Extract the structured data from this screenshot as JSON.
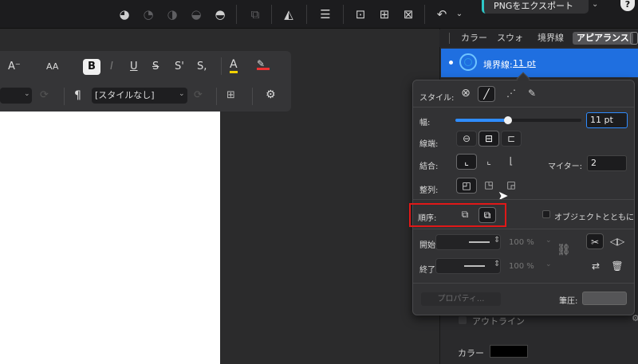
{
  "topbar": {
    "export_label": "PNGをエクスポート",
    "export_chevron": "⌄",
    "help_label": "?"
  },
  "textbar": {
    "font_decrease": "A⁻",
    "font_size_label": "AA",
    "bold": "B",
    "italic": "I",
    "underline": "U",
    "strike": "S",
    "superscript": "S'",
    "subscript": "S,",
    "pilcrow": "¶",
    "paragraph_style": "[スタイルなし]"
  },
  "right_panel": {
    "tabs": [
      {
        "label": "カラー"
      },
      {
        "label": "スウォ"
      },
      {
        "label": "境界線"
      },
      {
        "label": "アピアランス"
      }
    ],
    "stroke_label": "境界線:",
    "stroke_value": "11 pt",
    "outline_label": "アウトライン",
    "color_label": "カラー"
  },
  "popover": {
    "style_label": "スタイル:",
    "width_label": "幅:",
    "width_value": "11 pt",
    "width_fraction": 0.42,
    "cap_label": "線端:",
    "join_label": "結合:",
    "miter_label": "マイター:",
    "miter_value": "2",
    "align_label": "整列:",
    "order_label": "順序:",
    "with_object_label": "オブジェクトとともに",
    "start_label": "開始位置:",
    "end_label": "終了位置:",
    "start_pct": "100 %",
    "end_pct": "100 %",
    "properties_label": "プロパティ...",
    "pressure_label": "筆圧:"
  }
}
